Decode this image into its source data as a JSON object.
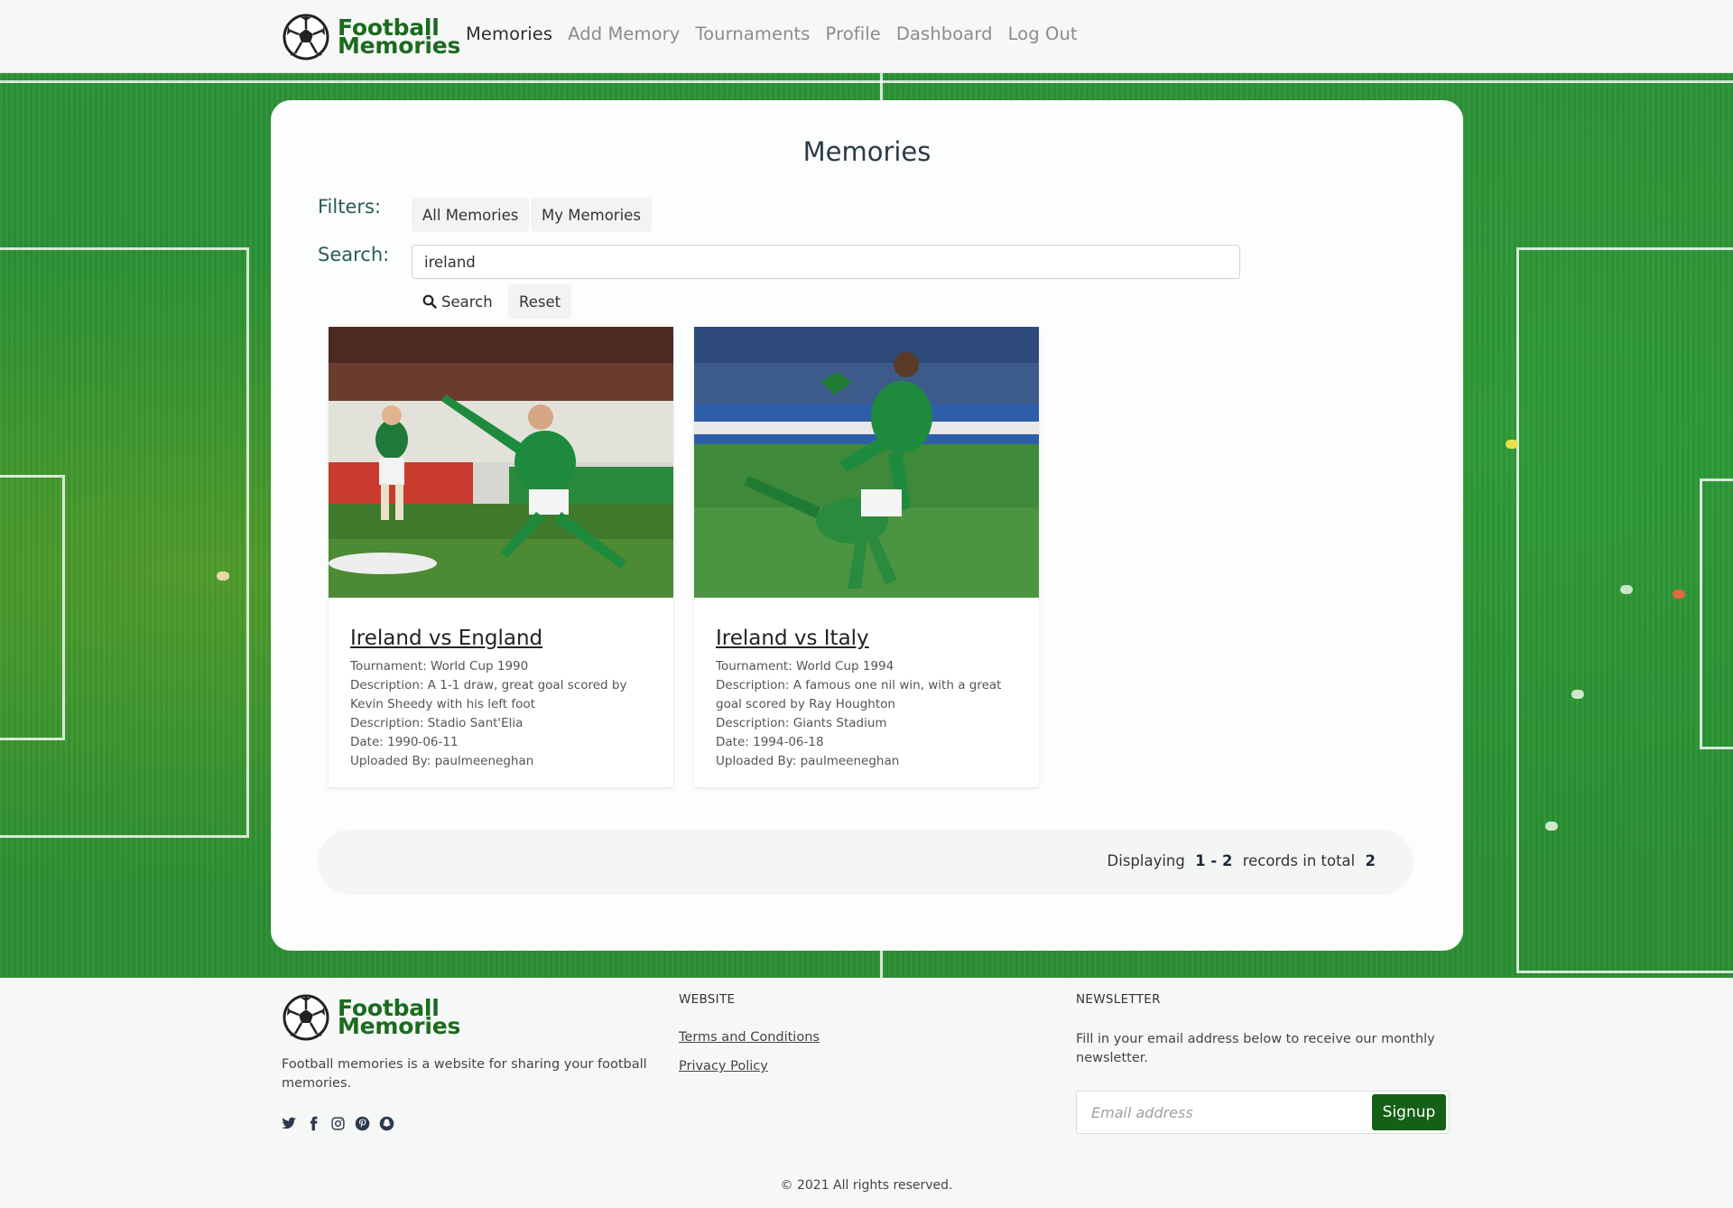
{
  "brand": {
    "line1": "Football",
    "line2": "Memories"
  },
  "nav": {
    "items": [
      {
        "label": "Memories",
        "active": true
      },
      {
        "label": "Add Memory",
        "active": false
      },
      {
        "label": "Tournaments",
        "active": false
      },
      {
        "label": "Profile",
        "active": false
      },
      {
        "label": "Dashboard",
        "active": false
      },
      {
        "label": "Log Out",
        "active": false
      }
    ]
  },
  "main": {
    "title": "Memories",
    "filters_label": "Filters:",
    "filter_all": "All Memories",
    "filter_mine": "My Memories",
    "search_label": "Search:",
    "search_value": "ireland",
    "search_button": "Search",
    "reset_button": "Reset",
    "memories": [
      {
        "title": "Ireland vs England",
        "tournament": "Tournament: World Cup 1990",
        "description": "Description: A 1-1 draw, great goal scored by Kevin Sheedy with his left foot",
        "venue": "Description: Stadio Sant'Elia",
        "date": "Date: 1990-06-11",
        "uploaded_by": "Uploaded By: paulmeeneghan"
      },
      {
        "title": "Ireland vs Italy",
        "tournament": "Tournament: World Cup 1994",
        "description": "Description: A famous one nil win, with a great goal scored by Ray Houghton",
        "venue": "Description: Giants Stadium",
        "date": "Date: 1994-06-18",
        "uploaded_by": "Uploaded By: paulmeeneghan"
      }
    ],
    "pager": {
      "prefix": "Displaying",
      "range": "1 - 2",
      "middle": "records in total",
      "total": "2"
    }
  },
  "footer": {
    "about": "Football memories is a website for sharing your football memories.",
    "website_heading": "WEBSITE",
    "terms": "Terms and Conditions",
    "privacy": "Privacy Policy",
    "newsletter_heading": "NEWSLETTER",
    "newsletter_text": "Fill in your email address below to receive our monthly newsletter.",
    "email_placeholder": "Email address",
    "signup": "Signup",
    "copyright": "© 2021 All rights reserved.",
    "socials": [
      {
        "icon": "twitter-icon",
        "glyph": "🐦"
      },
      {
        "icon": "facebook-icon",
        "glyph": "f"
      },
      {
        "icon": "instagram-icon",
        "glyph": "◎"
      },
      {
        "icon": "pinterest-icon",
        "glyph": "P"
      },
      {
        "icon": "snapchat-icon",
        "glyph": "♦"
      }
    ]
  },
  "colors": {
    "brand_green": "#1c6b1f",
    "signup_green": "#146016",
    "pitch_green": "#2c9136"
  }
}
